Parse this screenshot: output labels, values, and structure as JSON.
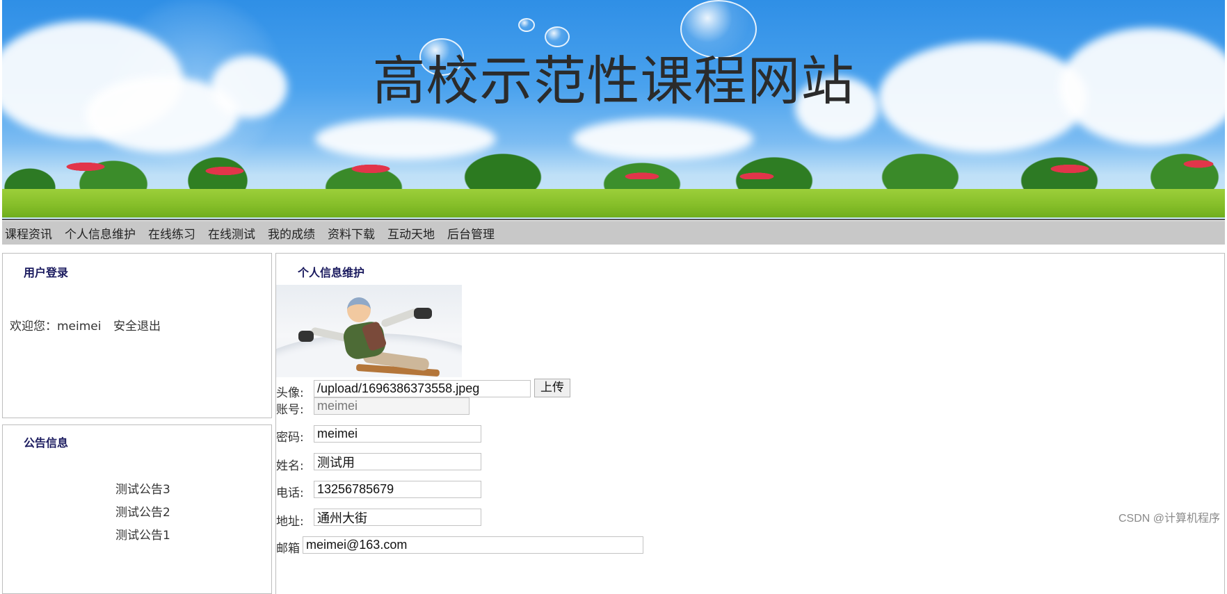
{
  "banner": {
    "title": "高校示范性课程网站"
  },
  "nav": {
    "items": [
      "课程资讯",
      "个人信息维护",
      "在线练习",
      "在线测试",
      "我的成绩",
      "资料下载",
      "互动天地",
      "后台管理"
    ]
  },
  "login_panel": {
    "title": "用户登录",
    "welcome": "欢迎您：meimei",
    "logout": "安全退出"
  },
  "notice_panel": {
    "title": "公告信息",
    "items": [
      "测试公告3",
      "测试公告2",
      "测试公告1"
    ]
  },
  "profile": {
    "title": "个人信息维护",
    "avatar_label": "头像:",
    "avatar_path": "/upload/1696386373558.jpeg",
    "upload_button": "上传",
    "account_label": "账号:",
    "account": "meimei",
    "password_label": "密码:",
    "password": "meimei",
    "name_label": "姓名:",
    "name": "测试用",
    "phone_label": "电话:",
    "phone": "13256785679",
    "address_label": "地址:",
    "address": "通州大街",
    "email_label": "邮箱",
    "email": "meimei@163.com"
  },
  "watermark": "CSDN @计算机程序"
}
